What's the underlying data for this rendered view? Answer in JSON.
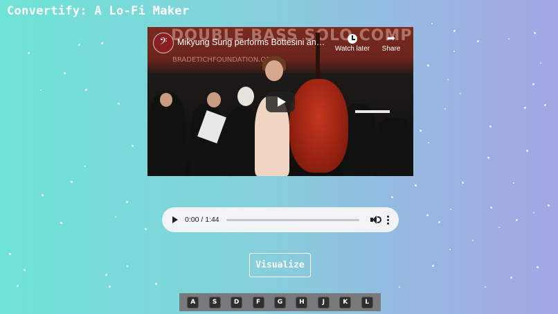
{
  "app": {
    "title": "Convertify: A Lo-Fi Maker"
  },
  "video": {
    "title": "Mikyung Sung performs Bottesini and s...",
    "channel_avatar": "bass-clef-icon",
    "banner_text": "DOUBLE BASS SOLO COMPETITION",
    "banner_url": "BRADETICHFOUNDATION.ORG",
    "watch_later_label": "Watch later",
    "share_label": "Share",
    "play_icon": "play-icon"
  },
  "audio": {
    "time": "0:00 / 1:44",
    "progress": 0.0,
    "icons": {
      "play": "play-icon",
      "volume": "volume-icon",
      "more": "more-vert-icon"
    }
  },
  "visualize_label": "Visualize",
  "keyboard": {
    "keys": [
      "A",
      "S",
      "D",
      "F",
      "G",
      "H",
      "J",
      "K",
      "L"
    ]
  },
  "colors": {
    "background_left": "#6fe3d6",
    "background_right": "#a3a6e4",
    "keyboard_bar": "#77797a",
    "key": "#2f2f2f"
  }
}
